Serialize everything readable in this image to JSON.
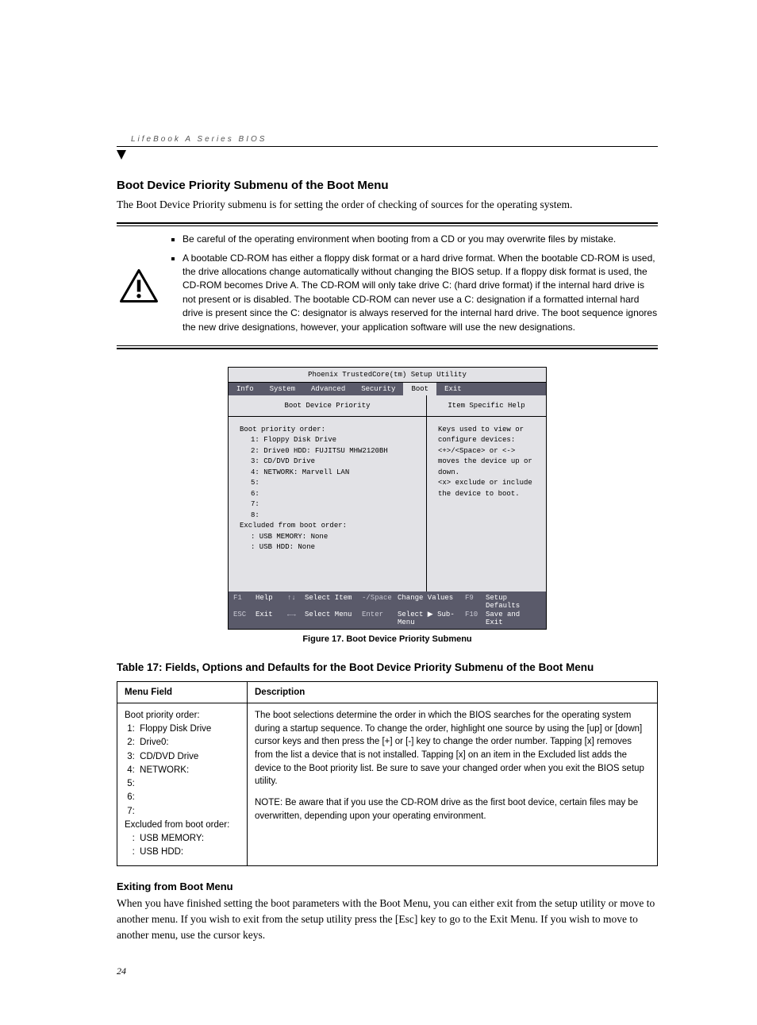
{
  "header": {
    "running": "LifeBook A Series BIOS"
  },
  "section": {
    "title": "Boot Device Priority Submenu of the Boot Menu",
    "intro": "The Boot Device Priority submenu is for setting the order of checking of sources for the operating system."
  },
  "notice": {
    "bullets": [
      "Be careful of the operating environment when booting from a CD or you may overwrite files by mistake.",
      "A bootable CD-ROM has either a floppy disk format or a hard drive format. When the bootable CD-ROM is used, the drive allocations change automatically without changing the BIOS setup. If a floppy disk format is used, the CD-ROM becomes Drive A. The CD-ROM will only take drive C: (hard drive format) if the internal hard drive is not present or is disabled. The bootable CD-ROM can never use a C: designation if a formatted internal hard drive is present since the C: designator is always reserved for the internal hard drive. The boot sequence ignores the new drive designations, however, your application software will use the new designations."
    ]
  },
  "bios": {
    "utility_title": "Phoenix TrustedCore(tm) Setup Utility",
    "tabs": [
      "Info",
      "System",
      "Advanced",
      "Security",
      "Boot",
      "Exit"
    ],
    "active_tab": "Boot",
    "left_title": "Boot Device Priority",
    "right_title": "Item Specific Help",
    "priority_label": "Boot priority order:",
    "priority_items": [
      "1:   Floppy Disk Drive",
      "2:   Drive0 HDD: FUJITSU MHW2120BH",
      "3:   CD/DVD Drive",
      "4:   NETWORK: Marvell LAN",
      "5:",
      "6:",
      "7:",
      "8:"
    ],
    "excluded_label": "Excluded from boot order:",
    "excluded_items": [
      ":   USB MEMORY: None",
      ":   USB HDD: None"
    ],
    "help_lines": [
      "Keys used to view or",
      "configure devices:",
      "",
      "<+>/<Space> or <->",
      "moves the device up or",
      "down.",
      "<x> exclude or include",
      "the device to boot."
    ],
    "footer": {
      "r1": [
        "F1",
        "Help",
        "↑↓",
        "Select Item",
        "-/Space",
        "Change Values",
        "F9",
        "Setup Defaults"
      ],
      "r2": [
        "ESC",
        "Exit",
        "←→",
        "Select Menu",
        "Enter",
        "Select ▶ Sub-Menu",
        "F10",
        "Save and Exit"
      ]
    }
  },
  "figure_caption": "Figure 17.  Boot Device Priority Submenu",
  "table": {
    "title": "Table 17: Fields, Options and Defaults for the Boot Device Priority Submenu of the Boot Menu",
    "col1": "Menu Field",
    "col2": "Description",
    "menu_field": "Boot priority order:\n 1:  Floppy Disk Drive\n 2:  Drive0:\n 3:  CD/DVD Drive\n 4:  NETWORK:\n 5:\n 6:\n 7:\nExcluded from boot order:\n   :  USB MEMORY:\n   :  USB HDD:",
    "description_p1": "The boot selections determine the order in which the BIOS searches for the operating system during a startup sequence. To change the order, highlight one source by using the [up] or [down] cursor keys and then press the [+] or [-] key to change the order number. Tapping [x] removes from the list a device that is not installed. Tapping [x] on an item in the Excluded list adds the device to the Boot priority list. Be sure to save your changed order when you exit the BIOS setup utility.",
    "description_p2": "NOTE: Be aware that if you use the CD-ROM drive as the first boot device, certain files may be overwritten, depending upon your operating environment."
  },
  "exiting": {
    "heading": "Exiting from Boot Menu",
    "body": "When you have finished setting the boot parameters with the Boot Menu, you can either exit from the setup utility or move to another menu. If you wish to exit from the setup utility press the [Esc] key to go to the Exit Menu. If you wish to move to another menu, use the cursor keys."
  },
  "page_number": "24"
}
